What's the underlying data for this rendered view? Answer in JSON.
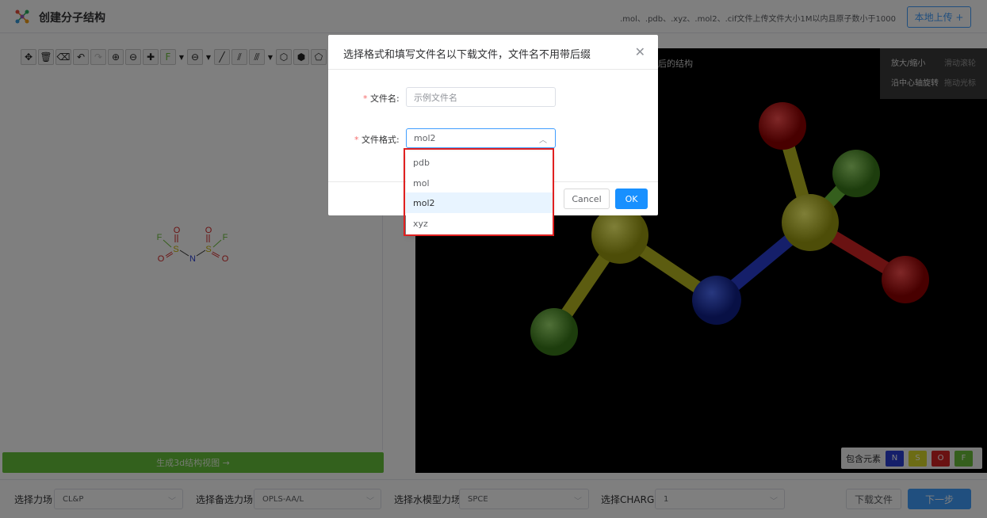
{
  "header": {
    "title": "创建分子结构",
    "hint": ".mol、.pdb、.xyz、.mol2、.cif文件上传文件大小1M以内且原子数小于1000",
    "upload_label": "本地上传 +"
  },
  "toolbar": {
    "element_button": "F"
  },
  "left_panel": {
    "generate_label": "生成3d结构视图 →"
  },
  "molecule_2d": {
    "atoms": [
      "F",
      "S",
      "O",
      "O",
      "N",
      "S",
      "O",
      "O",
      "F"
    ]
  },
  "viewer": {
    "title_partial": "后的结构",
    "help": [
      {
        "action": "放大/缩小",
        "control": "滑动滚轮"
      },
      {
        "action": "沿中心轴旋转",
        "control": "拖动光标"
      }
    ],
    "legend_label": "包含元素",
    "elements": [
      {
        "symbol": "N",
        "color": "#2a3fd4"
      },
      {
        "symbol": "S",
        "color": "#d8d82a"
      },
      {
        "symbol": "O",
        "color": "#d42424"
      },
      {
        "symbol": "F",
        "color": "#6bbf3a"
      }
    ]
  },
  "bottom": {
    "force_field_label": "选择力场",
    "force_field_value": "CL&P",
    "backup_field_label": "选择备选力场",
    "backup_field_value": "OPLS-AA/L",
    "water_label": "选择水模型力场",
    "water_value": "SPCE",
    "charge_label": "选择CHARGE",
    "charge_value": "1",
    "download_label": "下载文件",
    "next_label": "下一步"
  },
  "dialog": {
    "title": "选择格式和填写文件名以下载文件，文件名不用带后缀",
    "filename_label": "文件名:",
    "filename_placeholder": "示例文件名",
    "format_label": "文件格式:",
    "format_value": "mol2",
    "options": [
      "pdb",
      "mol",
      "mol2",
      "xyz"
    ],
    "selected_option": "mol2",
    "cancel_label": "Cancel",
    "ok_label": "OK"
  }
}
